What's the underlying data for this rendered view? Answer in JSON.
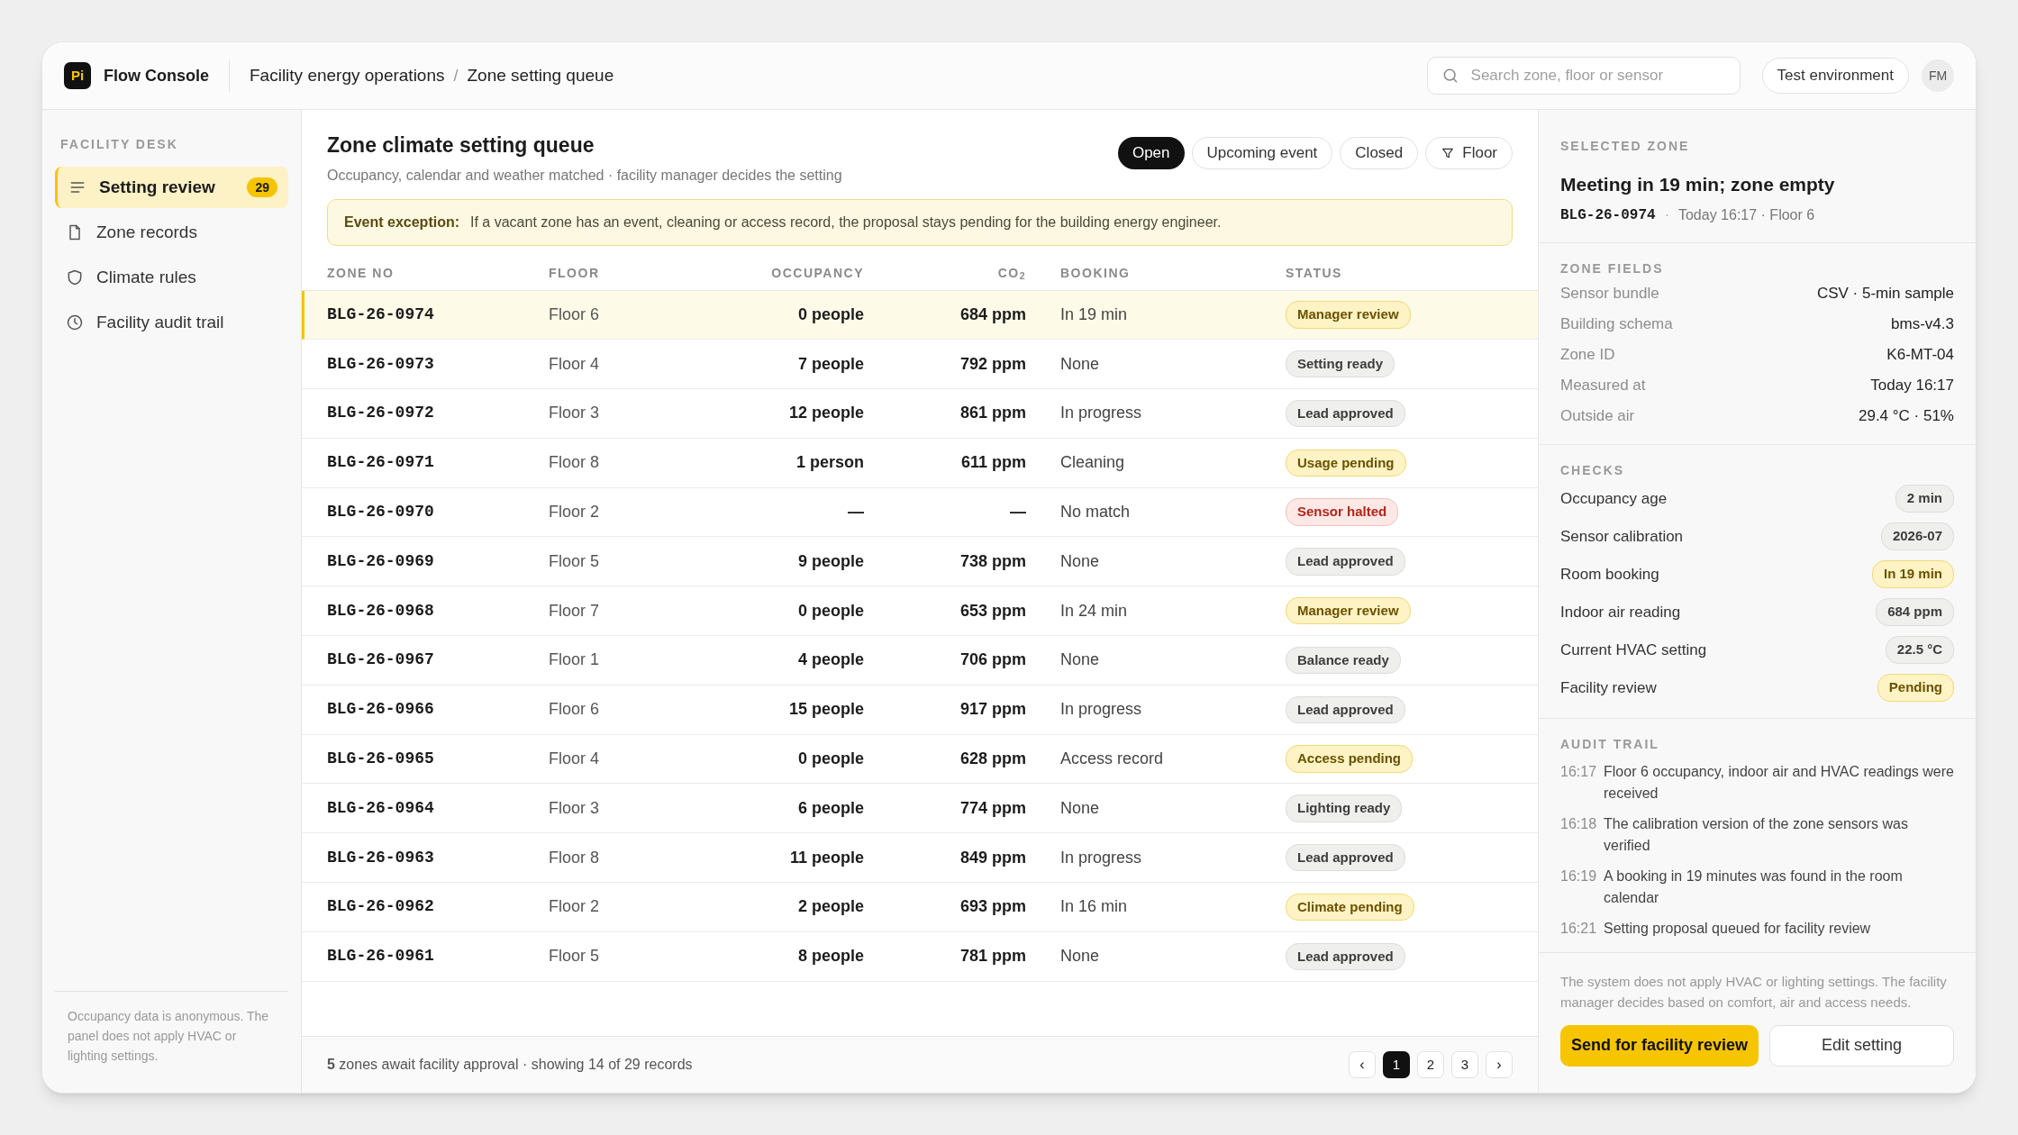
{
  "app": {
    "logo": "Pi",
    "name": "Flow Console"
  },
  "breadcrumb": [
    "Facility energy operations",
    "Zone setting queue"
  ],
  "breadcrumb_separator": "/",
  "search": {
    "placeholder": "Search zone, floor or sensor"
  },
  "environment": "Test environment",
  "user_initials": "FM",
  "sidebar": {
    "heading": "FACILITY DESK",
    "items": [
      {
        "label": "Setting review",
        "badge": "29",
        "selected": true
      },
      {
        "label": "Zone records",
        "selected": false
      },
      {
        "label": "Climate rules",
        "selected": false
      },
      {
        "label": "Facility audit trail",
        "selected": false
      }
    ],
    "note": "Occupancy data is anonymous. The panel does not apply HVAC or lighting settings."
  },
  "main": {
    "title": "Zone climate setting queue",
    "subtitle": "Occupancy, calendar and weather matched · facility manager decides the setting",
    "filters": [
      {
        "label": "Open",
        "selected": true
      },
      {
        "label": "Upcoming event",
        "selected": false
      },
      {
        "label": "Closed",
        "selected": false
      },
      {
        "label": "Floor",
        "kind": "filter",
        "selected": false
      }
    ],
    "notice": {
      "label": "Event exception:",
      "text": "If a vacant zone has an event, cleaning or access record, the proposal stays pending for the building energy engineer."
    },
    "table": {
      "columns": [
        "ZONE NO",
        "FLOOR",
        "OCCUPANCY",
        "CO$_{2}$",
        "BOOKING",
        "STATUS"
      ],
      "rows": [
        {
          "zone": "BLG-26-0974",
          "floor": "Floor 6",
          "occupancy": "0 people",
          "co2": "684 ppm",
          "booking": "In 19 min",
          "status": "Manager review",
          "kind": "warning",
          "selected": true
        },
        {
          "zone": "BLG-26-0973",
          "floor": "Floor 4",
          "occupancy": "7 people",
          "co2": "792 ppm",
          "booking": "None",
          "status": "Setting ready",
          "kind": "neutral",
          "selected": false
        },
        {
          "zone": "BLG-26-0972",
          "floor": "Floor 3",
          "occupancy": "12 people",
          "co2": "861 ppm",
          "booking": "In progress",
          "status": "Lead approved",
          "kind": "neutral",
          "selected": false
        },
        {
          "zone": "BLG-26-0971",
          "floor": "Floor 8",
          "occupancy": "1 person",
          "co2": "611 ppm",
          "booking": "Cleaning",
          "status": "Usage pending",
          "kind": "warning",
          "selected": false
        },
        {
          "zone": "BLG-26-0970",
          "floor": "Floor 2",
          "occupancy": "—",
          "co2": "—",
          "booking": "No match",
          "status": "Sensor halted",
          "kind": "danger",
          "selected": false
        },
        {
          "zone": "BLG-26-0969",
          "floor": "Floor 5",
          "occupancy": "9 people",
          "co2": "738 ppm",
          "booking": "None",
          "status": "Lead approved",
          "kind": "neutral",
          "selected": false
        },
        {
          "zone": "BLG-26-0968",
          "floor": "Floor 7",
          "occupancy": "0 people",
          "co2": "653 ppm",
          "booking": "In 24 min",
          "status": "Manager review",
          "kind": "warning",
          "selected": false
        },
        {
          "zone": "BLG-26-0967",
          "floor": "Floor 1",
          "occupancy": "4 people",
          "co2": "706 ppm",
          "booking": "None",
          "status": "Balance ready",
          "kind": "neutral",
          "selected": false
        },
        {
          "zone": "BLG-26-0966",
          "floor": "Floor 6",
          "occupancy": "15 people",
          "co2": "917 ppm",
          "booking": "In progress",
          "status": "Lead approved",
          "kind": "neutral",
          "selected": false
        },
        {
          "zone": "BLG-26-0965",
          "floor": "Floor 4",
          "occupancy": "0 people",
          "co2": "628 ppm",
          "booking": "Access record",
          "status": "Access pending",
          "kind": "warning",
          "selected": false
        },
        {
          "zone": "BLG-26-0964",
          "floor": "Floor 3",
          "occupancy": "6 people",
          "co2": "774 ppm",
          "booking": "None",
          "status": "Lighting ready",
          "kind": "neutral",
          "selected": false
        },
        {
          "zone": "BLG-26-0963",
          "floor": "Floor 8",
          "occupancy": "11 people",
          "co2": "849 ppm",
          "booking": "In progress",
          "status": "Lead approved",
          "kind": "neutral",
          "selected": false
        },
        {
          "zone": "BLG-26-0962",
          "floor": "Floor 2",
          "occupancy": "2 people",
          "co2": "693 ppm",
          "booking": "In 16 min",
          "status": "Climate pending",
          "kind": "warning",
          "selected": false
        },
        {
          "zone": "BLG-26-0961",
          "floor": "Floor 5",
          "occupancy": "8 people",
          "co2": "781 ppm",
          "booking": "None",
          "status": "Lead approved",
          "kind": "neutral",
          "selected": false
        }
      ]
    },
    "footer": "**5** zones await facility approval · showing 14 of 29 records",
    "pagination": {
      "prev": "‹",
      "pages": [
        {
          "label": "1",
          "selected": true
        },
        {
          "label": "2",
          "selected": false
        },
        {
          "label": "3",
          "selected": false
        }
      ],
      "next": "›"
    }
  },
  "detail": {
    "heading": "SELECTED ZONE",
    "title": "Meeting in 19 min; zone empty",
    "zone": "BLG-26-0974",
    "meta_separator": "·",
    "meta": "Today 16:17 · Floor 6",
    "fields_heading": "ZONE FIELDS",
    "fields": [
      {
        "label": "Sensor bundle",
        "value": "CSV · 5-min sample"
      },
      {
        "label": "Building schema",
        "value": "bms-v4.3"
      },
      {
        "label": "Zone ID",
        "value": "K6-MT-04"
      },
      {
        "label": "Measured at",
        "value": "Today 16:17"
      },
      {
        "label": "Outside air",
        "value": "29.4 °C · 51%"
      }
    ],
    "checks_heading": "CHECKS",
    "checks": [
      {
        "label": "Occupancy age",
        "value": "2 min",
        "kind": "neutral"
      },
      {
        "label": "Sensor calibration",
        "value": "2026-07",
        "kind": "neutral"
      },
      {
        "label": "Room booking",
        "value": "In 19 min",
        "kind": "warning"
      },
      {
        "label": "Indoor air reading",
        "value": "684 ppm",
        "kind": "neutral"
      },
      {
        "label": "Current HVAC setting",
        "value": "22.5 °C",
        "kind": "neutral"
      },
      {
        "label": "Facility review",
        "value": "Pending",
        "kind": "warning"
      }
    ],
    "audit_heading": "AUDIT TRAIL",
    "audit": [
      {
        "time": "16:17",
        "text": "Floor 6 occupancy, indoor air and HVAC readings were received"
      },
      {
        "time": "16:18",
        "text": "The calibration version of the zone sensors was verified"
      },
      {
        "time": "16:19",
        "text": "A booking in 19 minutes was found in the room calendar"
      },
      {
        "time": "16:21",
        "text": "Setting proposal queued for facility review"
      }
    ],
    "disclaimer": "The system does not apply HVAC or lighting settings. The facility manager decides based on comfort, air and access needs.",
    "primary_button": "Send for facility review",
    "secondary_button": "Edit setting"
  }
}
